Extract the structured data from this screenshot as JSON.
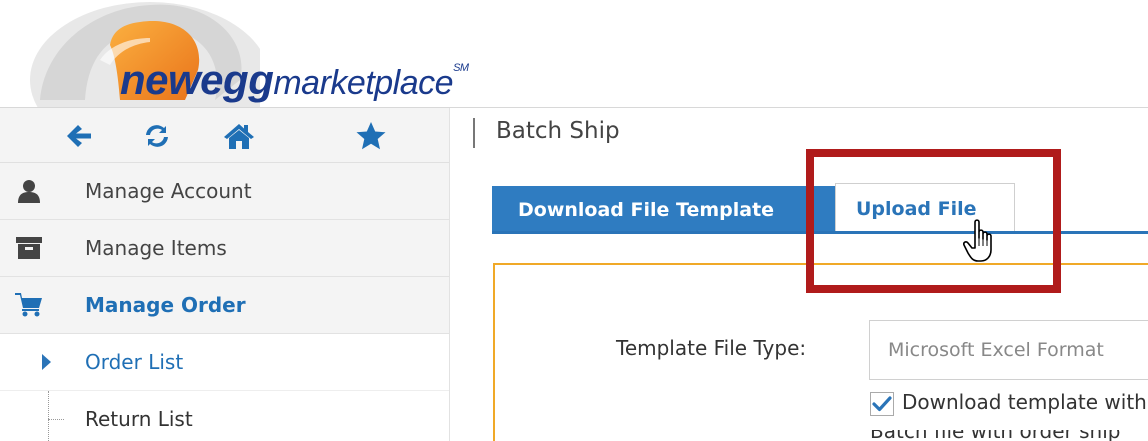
{
  "logo": {
    "brand": "newegg",
    "suffix": "marketplace",
    "service_mark": "SM",
    "colors": {
      "orange": "#f28a1e",
      "navy": "#1a3a8c"
    }
  },
  "toolbar": {
    "icons": [
      "arrow-left-icon",
      "refresh-icon",
      "home-icon",
      "star-icon"
    ]
  },
  "sidebar": {
    "items": [
      {
        "label": "Manage Account",
        "icon": "user-icon"
      },
      {
        "label": "Manage Items",
        "icon": "archive-icon"
      },
      {
        "label": "Manage Order",
        "icon": "cart-icon",
        "active": true
      }
    ],
    "subitems": [
      {
        "label": "Order List",
        "current": true
      },
      {
        "label": "Return List"
      }
    ]
  },
  "page": {
    "title": "Batch Ship"
  },
  "tabs": [
    {
      "label": "Download File Template",
      "selected": true
    },
    {
      "label": "Upload File",
      "selected": false
    }
  ],
  "form": {
    "template_type_label": "Template File Type:",
    "template_type_value": "Microsoft Excel Format",
    "download_checkbox_label": "Download template with",
    "download_checkbox_checked": true,
    "next_row_text": "Batch file with order ship"
  },
  "annotation": {
    "highlight_color": "#b01b1b"
  },
  "colors": {
    "accent_blue": "#2f7cc1",
    "panel_border": "#f0a928"
  }
}
